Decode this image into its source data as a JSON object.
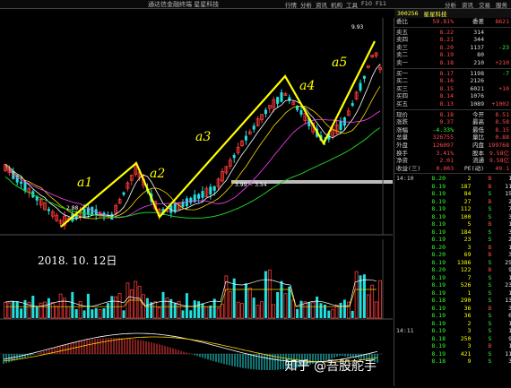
{
  "window": {
    "title": "通达信金融终端 星星科技",
    "menu": [
      "行情",
      "分析",
      "资讯",
      "机构",
      "工具",
      "F10",
      "F11"
    ],
    "right_menu": [
      "分析",
      "资讯",
      "交易",
      "服务"
    ]
  },
  "chart": {
    "date_label": "2018. 10. 12日",
    "low_label": "2.88",
    "mid_band_label": "3.99 ~ 3.54",
    "peak_label": "9.93",
    "wave_labels": [
      "a1",
      "a2",
      "a3",
      "a4",
      "a5"
    ],
    "colors": {
      "wave": "#ffff00",
      "up": "#ff3a3a",
      "down": "#22e0e0",
      "ma5": "#ffffff",
      "ma10": "#ffd700",
      "ma20": "#ff44ff",
      "ma60": "#22cc22"
    }
  },
  "quote": {
    "code": "300256",
    "name": "星星科技",
    "ratio_label": "委比",
    "ratio_value": "59.81%",
    "diff_label": "委差",
    "diff_value": "8621",
    "sell_book": [
      {
        "label": "卖五",
        "price": "8.22",
        "volume": "314"
      },
      {
        "label": "卖四",
        "price": "8.21",
        "volume": "344"
      },
      {
        "label": "卖三",
        "price": "8.20",
        "volume": "1137",
        "change": "-23"
      },
      {
        "label": "卖二",
        "price": "8.19",
        "volume": "80"
      },
      {
        "label": "卖一",
        "price": "8.18",
        "volume": "210",
        "change": "+210"
      }
    ],
    "buy_book": [
      {
        "label": "买一",
        "price": "8.17",
        "volume": "1198",
        "change": "-7"
      },
      {
        "label": "买二",
        "price": "8.16",
        "volume": "2126"
      },
      {
        "label": "买三",
        "price": "8.15",
        "volume": "6021",
        "change": "+10"
      },
      {
        "label": "买四",
        "price": "8.14",
        "volume": "1076"
      },
      {
        "label": "买五",
        "price": "8.13",
        "volume": "1089",
        "change": "+1002"
      }
    ],
    "stats": [
      {
        "l1": "现价",
        "v1": "8.18",
        "l2": "今开",
        "v2": "8.51"
      },
      {
        "l1": "涨跌",
        "v1": "0.37",
        "l2": "最高",
        "v2": "8.58"
      },
      {
        "l1": "涨幅",
        "v1": "-4.33%",
        "l2": "最低",
        "v2": "8.15"
      },
      {
        "l1": "总量",
        "v1": "326755",
        "l2": "量比",
        "v2": "0.88"
      },
      {
        "l1": "外盘",
        "v1": "126097",
        "l2": "内盘",
        "v2": "199768"
      },
      {
        "l1": "换手",
        "v1": "3.41%",
        "l2": "股本",
        "v2": "9.58亿"
      },
      {
        "l1": "净资",
        "v1": "2.01",
        "l2": "流通",
        "v2": "9.58亿"
      },
      {
        "l1": "收益(三)",
        "v1": "0.003",
        "l2": "PE(动)",
        "v2": "49.1"
      }
    ],
    "ticks": [
      {
        "time": "14:10",
        "price": "8.20",
        "vol": "2",
        "side": "B",
        "n": "1"
      },
      {
        "time": "",
        "price": "8.19",
        "vol": "187",
        "side": "B",
        "n": "11"
      },
      {
        "time": "",
        "price": "8.19",
        "vol": "84",
        "side": "S",
        "n": "15"
      },
      {
        "time": "",
        "price": "8.19",
        "vol": "27",
        "side": "B",
        "n": "2"
      },
      {
        "time": "",
        "price": "8.19",
        "vol": "112",
        "side": "S",
        "n": "7"
      },
      {
        "time": "",
        "price": "8.19",
        "vol": "100",
        "side": "S",
        "n": "3"
      },
      {
        "time": "",
        "price": "8.19",
        "vol": "5",
        "side": "B",
        "n": "1"
      },
      {
        "time": "",
        "price": "8.19",
        "vol": "184",
        "side": "S",
        "n": "3"
      },
      {
        "time": "",
        "price": "8.19",
        "vol": "23",
        "side": "S",
        "n": "2"
      },
      {
        "time": "",
        "price": "8.20",
        "vol": "3",
        "side": "B",
        "n": "1"
      },
      {
        "time": "",
        "price": "8.20",
        "vol": "69",
        "side": "B",
        "n": "3"
      },
      {
        "time": "",
        "price": "8.19",
        "vol": "1386",
        "side": "S",
        "n": "25"
      },
      {
        "time": "",
        "price": "8.20",
        "vol": "122",
        "side": "B",
        "n": "9"
      },
      {
        "time": "",
        "price": "8.19",
        "vol": "7",
        "side": "S",
        "n": "1"
      },
      {
        "time": "",
        "price": "8.19",
        "vol": "526",
        "side": "S",
        "n": "23"
      },
      {
        "time": "",
        "price": "8.19",
        "vol": "1",
        "side": "S",
        "n": "1"
      },
      {
        "time": "",
        "price": "8.18",
        "vol": "290",
        "side": "S",
        "n": "13"
      },
      {
        "time": "",
        "price": "8.19",
        "vol": "36",
        "side": "B",
        "n": "3"
      },
      {
        "time": "",
        "price": "8.19",
        "vol": "36",
        "side": "S",
        "n": "6"
      },
      {
        "time": "",
        "price": "8.19",
        "vol": "2",
        "side": "S",
        "n": "1"
      },
      {
        "time": "14:11",
        "price": "8.19",
        "vol": "3",
        "side": "S",
        "n": "1"
      },
      {
        "time": "",
        "price": "8.18",
        "vol": "250",
        "side": "S",
        "n": "9"
      },
      {
        "time": "",
        "price": "8.19",
        "vol": "3",
        "side": "B",
        "n": "1"
      },
      {
        "time": "",
        "price": "8.19",
        "vol": "421",
        "side": "S",
        "n": "11"
      },
      {
        "time": "",
        "price": "8.18",
        "vol": "9",
        "side": "S",
        "n": "3"
      }
    ]
  },
  "watermark": "知乎 @吾股舵手"
}
